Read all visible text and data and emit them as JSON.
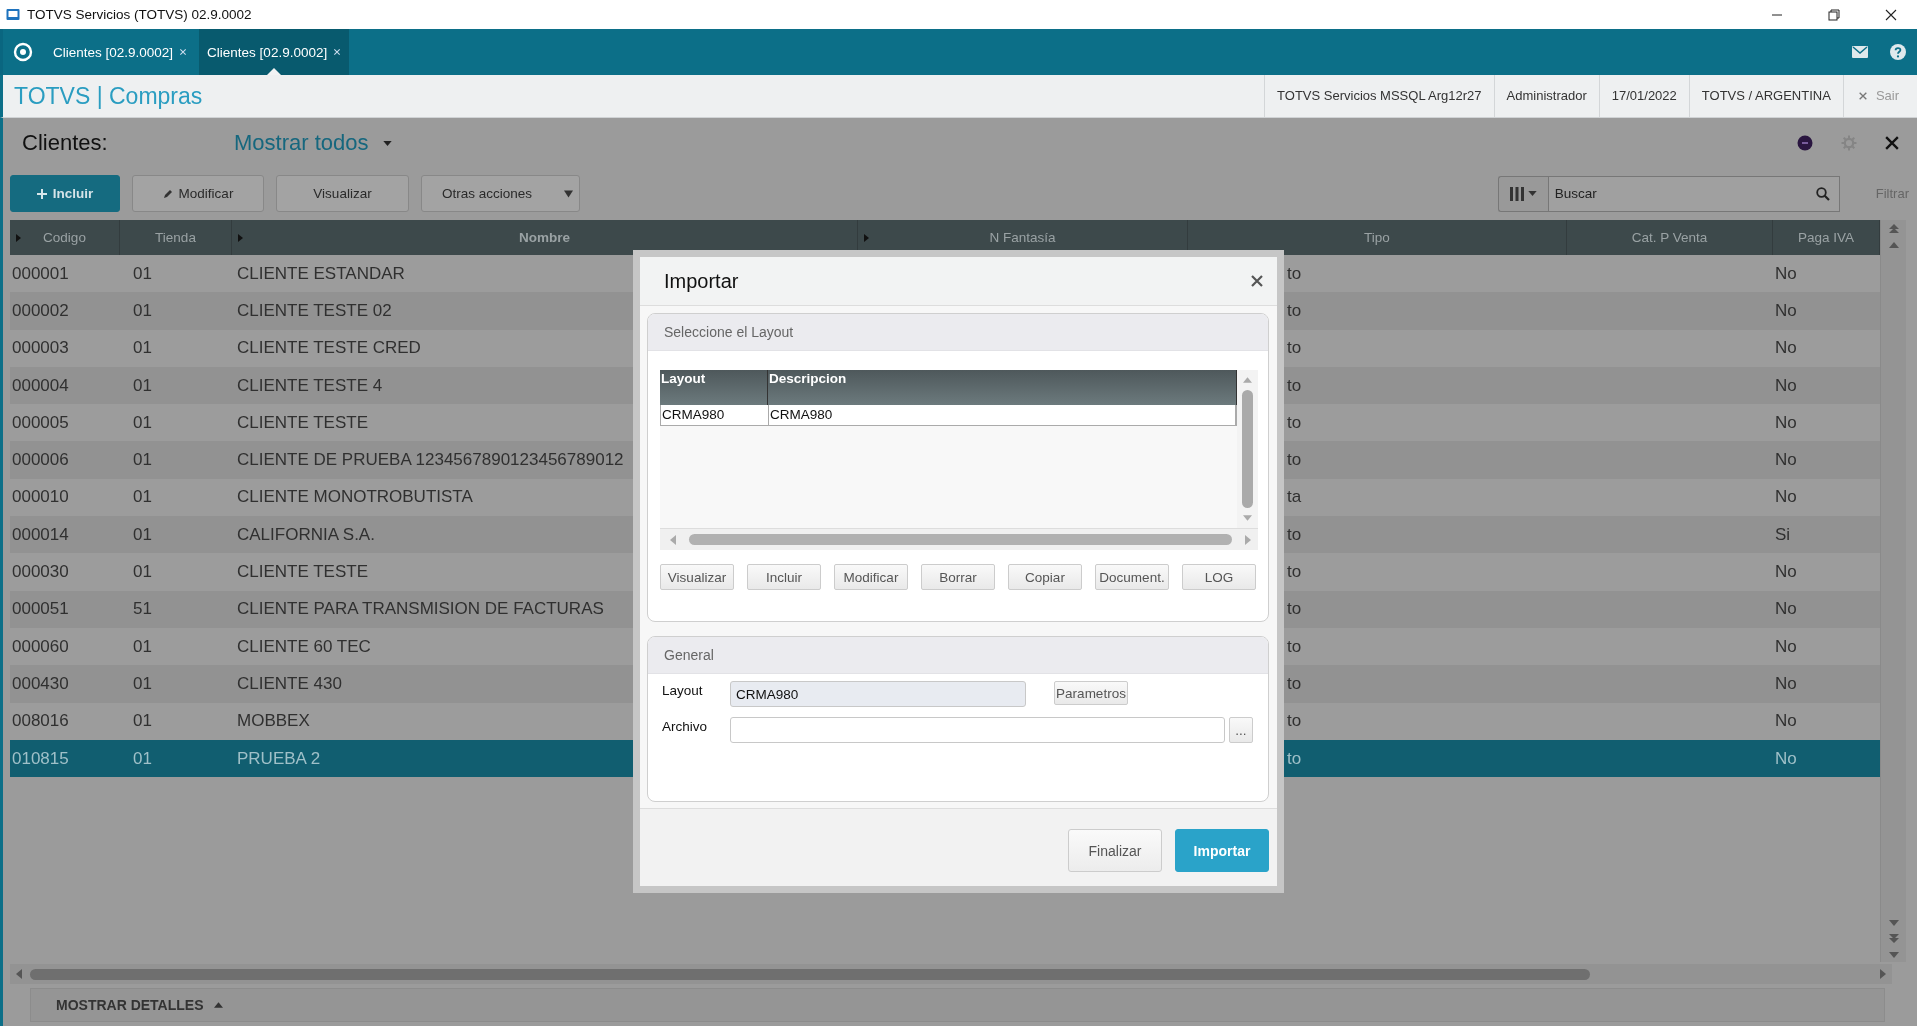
{
  "window": {
    "title": "TOTVS Servicios (TOTVS) 02.9.0002"
  },
  "app_tabs": [
    {
      "label": "Clientes [02.9.0002]",
      "selected": false
    },
    {
      "label": "Clientes [02.9.0002]",
      "selected": true
    }
  ],
  "header": {
    "module": "TOTVS | Compras",
    "info": [
      "TOTVS Servicios MSSQL Arg12r27",
      "Administrador",
      "17/01/2022",
      "TOTVS / ARGENTINA"
    ],
    "logout": "Sair"
  },
  "page": {
    "title": "Clientes:",
    "filter": "Mostrar todos"
  },
  "toolbar": {
    "buttons": [
      {
        "label": "Incluir",
        "kind": "primary"
      },
      {
        "label": "Modificar",
        "kind": "edit"
      },
      {
        "label": "Visualizar",
        "kind": "plain"
      },
      {
        "label": "Otras acciones",
        "kind": "dropdown"
      }
    ],
    "search": {
      "placeholder": "Buscar"
    },
    "filter_link": "Filtrar"
  },
  "table": {
    "columns": [
      {
        "label": "Codigo",
        "arrow": true
      },
      {
        "label": "Tienda",
        "arrow": false
      },
      {
        "label": "Nombre",
        "arrow": true
      },
      {
        "label": "N Fantasía",
        "arrow": true
      },
      {
        "label": "Tipo",
        "arrow": false
      },
      {
        "label": "Cat. P Venta",
        "arrow": false
      },
      {
        "label": "Paga IVA",
        "arrow": false
      }
    ],
    "rows": [
      {
        "codigo": "000001",
        "tienda": "01",
        "nombre": "CLIENTE ESTANDAR",
        "tipo": "to",
        "paga_iva": "No",
        "selected": false
      },
      {
        "codigo": "000002",
        "tienda": "01",
        "nombre": "CLIENTE TESTE 02",
        "tipo": "to",
        "paga_iva": "No",
        "selected": false
      },
      {
        "codigo": "000003",
        "tienda": "01",
        "nombre": "CLIENTE TESTE CRED",
        "tipo": "to",
        "paga_iva": "No",
        "selected": false
      },
      {
        "codigo": "000004",
        "tienda": "01",
        "nombre": "CLIENTE TESTE 4",
        "tipo": "to",
        "paga_iva": "No",
        "selected": false
      },
      {
        "codigo": "000005",
        "tienda": "01",
        "nombre": "CLIENTE TESTE",
        "tipo": "to",
        "paga_iva": "No",
        "selected": false
      },
      {
        "codigo": "000006",
        "tienda": "01",
        "nombre": "CLIENTE DE PRUEBA 1234567890123456789012",
        "tipo": "to",
        "paga_iva": "No",
        "selected": false
      },
      {
        "codigo": "000010",
        "tienda": "01",
        "nombre": "CLIENTE MONOTROBUTISTA",
        "tipo": "ta",
        "paga_iva": "No",
        "selected": false
      },
      {
        "codigo": "000014",
        "tienda": "01",
        "nombre": "CALIFORNIA S.A.",
        "tipo": "to",
        "paga_iva": "Si",
        "selected": false
      },
      {
        "codigo": "000030",
        "tienda": "01",
        "nombre": "CLIENTE TESTE",
        "tipo": "to",
        "paga_iva": "No",
        "selected": false
      },
      {
        "codigo": "000051",
        "tienda": "51",
        "nombre": "CLIENTE PARA TRANSMISION DE FACTURAS",
        "tipo": "to",
        "paga_iva": "No",
        "selected": false
      },
      {
        "codigo": "000060",
        "tienda": "01",
        "nombre": "CLIENTE 60 TEC",
        "tipo": "to",
        "paga_iva": "No",
        "selected": false
      },
      {
        "codigo": "000430",
        "tienda": "01",
        "nombre": "CLIENTE 430",
        "tipo": "to",
        "paga_iva": "No",
        "selected": false
      },
      {
        "codigo": "008016",
        "tienda": "01",
        "nombre": "MOBBEX",
        "tipo": "to",
        "paga_iva": "No",
        "selected": false
      },
      {
        "codigo": "010815",
        "tienda": "01",
        "nombre": "PRUEBA 2",
        "tipo": "to",
        "paga_iva": "No",
        "selected": true
      }
    ]
  },
  "details_toggle": "MOSTRAR DETALLES",
  "dialog": {
    "title": "Importar",
    "layout_panel": {
      "title": "Seleccione el Layout",
      "grid": {
        "columns": [
          "Layout",
          "Descripcion"
        ],
        "rows": [
          [
            "CRMA980",
            "CRMA980"
          ]
        ]
      },
      "buttons": [
        "Visualizar",
        "Incluir",
        "Modificar",
        "Borrar",
        "Copiar",
        "Document.",
        "LOG"
      ]
    },
    "general_panel": {
      "title": "General",
      "fields": [
        {
          "label": "Layout",
          "value": "CRMA980",
          "kind": "readonly",
          "button": "Parametros"
        },
        {
          "label": "Archivo",
          "kind": "file",
          "button": "..."
        }
      ]
    },
    "footer_buttons": [
      {
        "label": "Finalizar",
        "kind": "secondary"
      },
      {
        "label": "Importar",
        "kind": "primary"
      }
    ]
  }
}
